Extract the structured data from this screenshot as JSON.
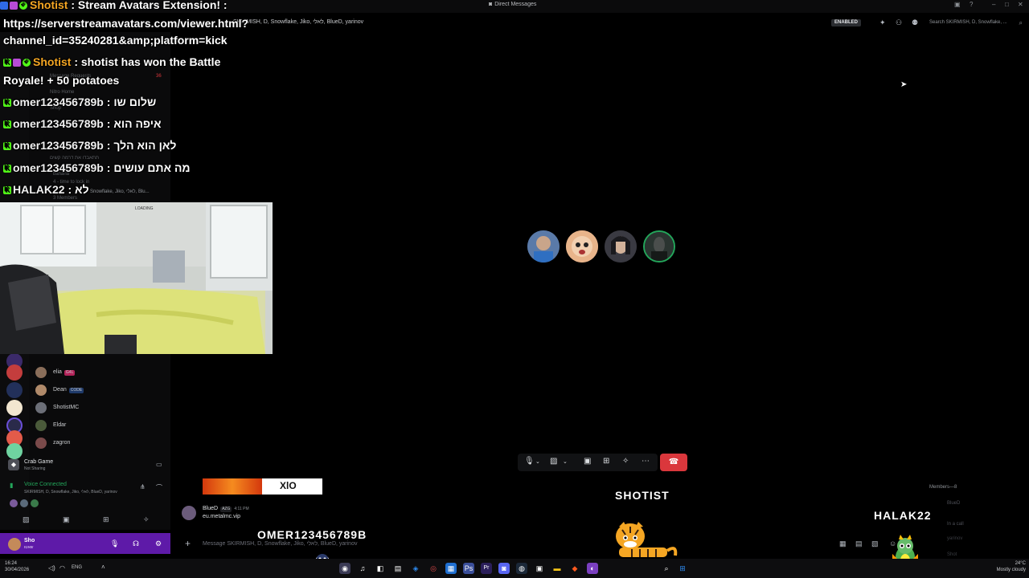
{
  "window": {
    "title": "Direct Messages",
    "title_icon": "discord-icon"
  },
  "header": {
    "members_line": "SKIRMISH, D, Snowflake, Jiko, לאלי, BlueD, yarinov",
    "enabled_badge": "ENABLED",
    "search_placeholder": "Search SKIRMISH, D, Snowflake, ..."
  },
  "sidebar": {
    "ghost_items": [
      "Message Requests",
      "Nitro Home",
      "Shop",
      "תתאבדו את דרמה קשים",
      "banana",
      "4 - time to lock in",
      "3 Members"
    ],
    "message_requests_count": "36",
    "members": [
      {
        "name": "elia",
        "tag": "G4L"
      },
      {
        "name": "Dean",
        "tag": "CODE"
      },
      {
        "name": "ShotistMC",
        "tag": ""
      },
      {
        "name": "Eldar",
        "tag": ""
      },
      {
        "name": "zagron",
        "tag": ""
      }
    ],
    "crab_game": {
      "title": "Crab Game",
      "subtitle": "Not Sharing"
    },
    "voice": {
      "status": "Voice Connected",
      "channel": "SKIRMISH, D, Snowflake, Jiko, לאלי, BlueD, yarinov"
    },
    "user": {
      "name": "Sho",
      "status": "שאטו"
    }
  },
  "chat_overlay": {
    "lines": [
      {
        "user": "Shotist",
        "text": ": Stream Avatars Extension! :"
      },
      {
        "url1": "https://serverstreamavatars.com/viewer.html?",
        "url2": "channel_id=35240281&amp;platform=kick"
      },
      {
        "user": "Shotist",
        "text": ": shotist has won the Battle"
      },
      {
        "text": "Royale! + 50 potatoes"
      },
      {
        "user": "omer123456789b",
        "text": ": שלום שו"
      },
      {
        "user": "omer123456789b",
        "text": ": איפה הוא"
      },
      {
        "user": "omer123456789b",
        "text": ": לאן הוא הלך"
      },
      {
        "user": "omer123456789b",
        "text": ": מה אתם עושים"
      },
      {
        "user": "HALAK22",
        "text": ": לא"
      }
    ],
    "faint_line": "Snowflake, Jiko, לאלי, Blu..."
  },
  "webcam": {
    "lamp_label": "LOADING"
  },
  "call": {
    "participant_count": 4
  },
  "bottom": {
    "banner_text": "XlO",
    "message": {
      "author": "BlueD",
      "tag": "AZG",
      "time": "4:11 PM",
      "text": "eu.metalmc.vip"
    },
    "input_placeholder": "Message SKIRMISH, D, Snowflake, Jiko, לאלי, BlueD, yarinov",
    "labels": {
      "shotist": "SHOTIST",
      "halak": "HALAK22",
      "omer": "OMER123456789B"
    },
    "members_count": "Members—8",
    "mem_right": [
      "BlueD",
      "In a call",
      "yarinov",
      "Shot"
    ]
  },
  "taskbar": {
    "time_left": "16:24",
    "date_left": "30/04/2026",
    "lang": "ENG",
    "temp": "24°C",
    "weather": "Mostly cloudy"
  },
  "colors": {
    "accent_purple": "#5e1aa8",
    "hangup_red": "#da373c",
    "kick_green": "#53fc18",
    "voice_green": "#23a55a"
  }
}
